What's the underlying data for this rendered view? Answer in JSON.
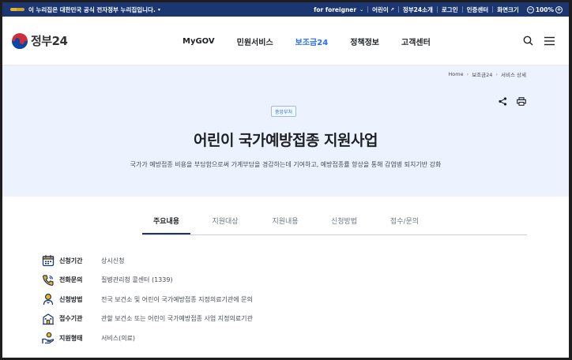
{
  "topbar": {
    "notice": "이 누리집은 대한민국 공식 전자정부 누리집입니다.",
    "links": [
      "for foreigner",
      "어린이",
      "정부24소개",
      "로그인",
      "인증센터",
      "화면크기"
    ],
    "zoom": "100%"
  },
  "header": {
    "logo": "정부24",
    "nav": [
      "MyGOV",
      "민원서비스",
      "보조금24",
      "정책정보",
      "고객센터"
    ]
  },
  "breadcrumb": [
    "Home",
    "보조금24",
    "서비스 상세"
  ],
  "page": {
    "badge": "중앙부처",
    "title": "어린이 국가예방접종 지원사업",
    "description": "국가가 예방접종 비용을 부담함으로써 가계부담을 경감하는데 기여하고, 예방접종률 향상을 통해 감염병 퇴치기반 강화"
  },
  "tabs": [
    "주요내용",
    "지원대상",
    "지원내용",
    "신청방법",
    "접수/문의"
  ],
  "info": [
    {
      "label": "신청기간",
      "value": "상시신청",
      "icon": "calendar-icon"
    },
    {
      "label": "전화문의",
      "value": "질병관리청 콜센터 (1339)",
      "icon": "phone-icon"
    },
    {
      "label": "신청방법",
      "value": "전국 보건소 및 어린이 국가예방접종 지정의료기관에 문의",
      "icon": "person-icon"
    },
    {
      "label": "접수기관",
      "value": "관할 보건소 또는 어린이 국가예방접종 사업 지정의료기관",
      "icon": "building-icon"
    },
    {
      "label": "지원형태",
      "value": "서비스(의료)",
      "icon": "hand-icon"
    }
  ],
  "colors": {
    "primary": "#256ef4",
    "navy": "#1b3670",
    "heroBg": "#ecf2fe",
    "iconYellow": "#f2b705"
  }
}
